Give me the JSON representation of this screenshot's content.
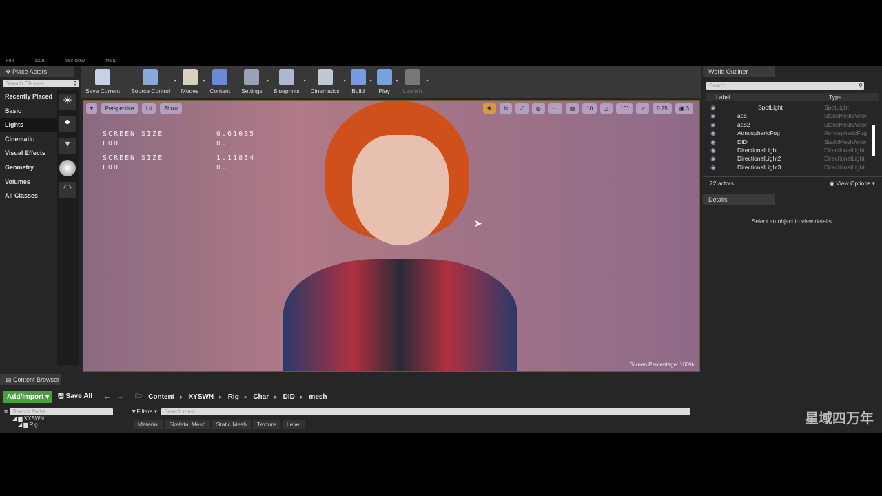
{
  "menu": [
    "File",
    "Edit",
    "Window",
    "Help"
  ],
  "place_actors": {
    "tab": "Place Actors",
    "search_placeholder": "Search Classes",
    "categories": [
      "Recently Placed",
      "Basic",
      "Lights",
      "Cinematic",
      "Visual Effects",
      "Geometry",
      "Volumes",
      "All Classes"
    ],
    "selected": "Lights"
  },
  "toolbar": [
    {
      "label": "Save Current",
      "icon": "save-icon",
      "color": "#c8d0e8",
      "dropdown": false
    },
    {
      "label": "Source Control",
      "icon": "source-control-icon",
      "color": "#8aa8d8",
      "dropdown": true
    },
    {
      "label": "Modes",
      "icon": "modes-icon",
      "color": "#d8d0c0",
      "dropdown": true
    },
    {
      "label": "Content",
      "icon": "content-icon",
      "color": "#6a8ad8",
      "dropdown": false
    },
    {
      "label": "Settings",
      "icon": "settings-icon",
      "color": "#9aa0b8",
      "dropdown": true
    },
    {
      "label": "Blueprints",
      "icon": "blueprints-icon",
      "color": "#b0b8d0",
      "dropdown": true
    },
    {
      "label": "Cinematics",
      "icon": "cinematics-icon",
      "color": "#c0c8d8",
      "dropdown": true
    },
    {
      "label": "Build",
      "icon": "build-icon",
      "color": "#7a9ae0",
      "dropdown": true
    },
    {
      "label": "Play",
      "icon": "play-icon",
      "color": "#7aa0e0",
      "dropdown": true
    },
    {
      "label": "Launch",
      "icon": "launch-icon",
      "color": "#777",
      "dropdown": true
    }
  ],
  "viewport": {
    "perspective": "Perspective",
    "lit": "Lit",
    "show": "Show",
    "stats": [
      {
        "k": "SCREEN SIZE",
        "v": "0.61085"
      },
      {
        "k": "LOD",
        "v": "0."
      },
      {
        "k": "SCREEN SIZE",
        "v": "1.11854"
      },
      {
        "k": "LOD",
        "v": "0."
      }
    ],
    "grid_snap": "10",
    "rot_snap": "10°",
    "scale_snap": "0.25",
    "camera_speed": "3",
    "screen_percentage": "Screen Percentage: 160%"
  },
  "outliner": {
    "tab": "World Outliner",
    "search_placeholder": "Search...",
    "col_label": "Label",
    "col_type": "Type",
    "rows": [
      {
        "label": "SpotLight",
        "type": "SpotLight"
      },
      {
        "label": "aas",
        "type": "StaticMeshActor"
      },
      {
        "label": "aas2",
        "type": "StaticMeshActor"
      },
      {
        "label": "AtmosphericFog",
        "type": "AtmosphericFog"
      },
      {
        "label": "DID",
        "type": "StaticMeshActor"
      },
      {
        "label": "DirectionalLight",
        "type": "DirectionalLight"
      },
      {
        "label": "DirectionalLight2",
        "type": "DirectionalLight"
      },
      {
        "label": "DirectionalLight3",
        "type": "DirectionalLight"
      }
    ],
    "count": "22 actors",
    "view_options": "View Options"
  },
  "details": {
    "tab": "Details",
    "empty": "Select an object to view details."
  },
  "content_browser": {
    "tab": "Content Browser",
    "add_import": "Add/Import",
    "save_all": "Save All",
    "breadcrumb": [
      "Content",
      "XYSWN",
      "Rig",
      "Char",
      "DID",
      "mesh"
    ],
    "search_paths_placeholder": "Search Paths",
    "filters": "Filters",
    "search_placeholder": "Search mesh",
    "filter_chips": [
      "Material",
      "Skeletal Mesh",
      "Static Mesh",
      "Texture",
      "Level"
    ],
    "tree": [
      "XYSWN",
      "Rig"
    ]
  },
  "watermark": "星域四万年"
}
